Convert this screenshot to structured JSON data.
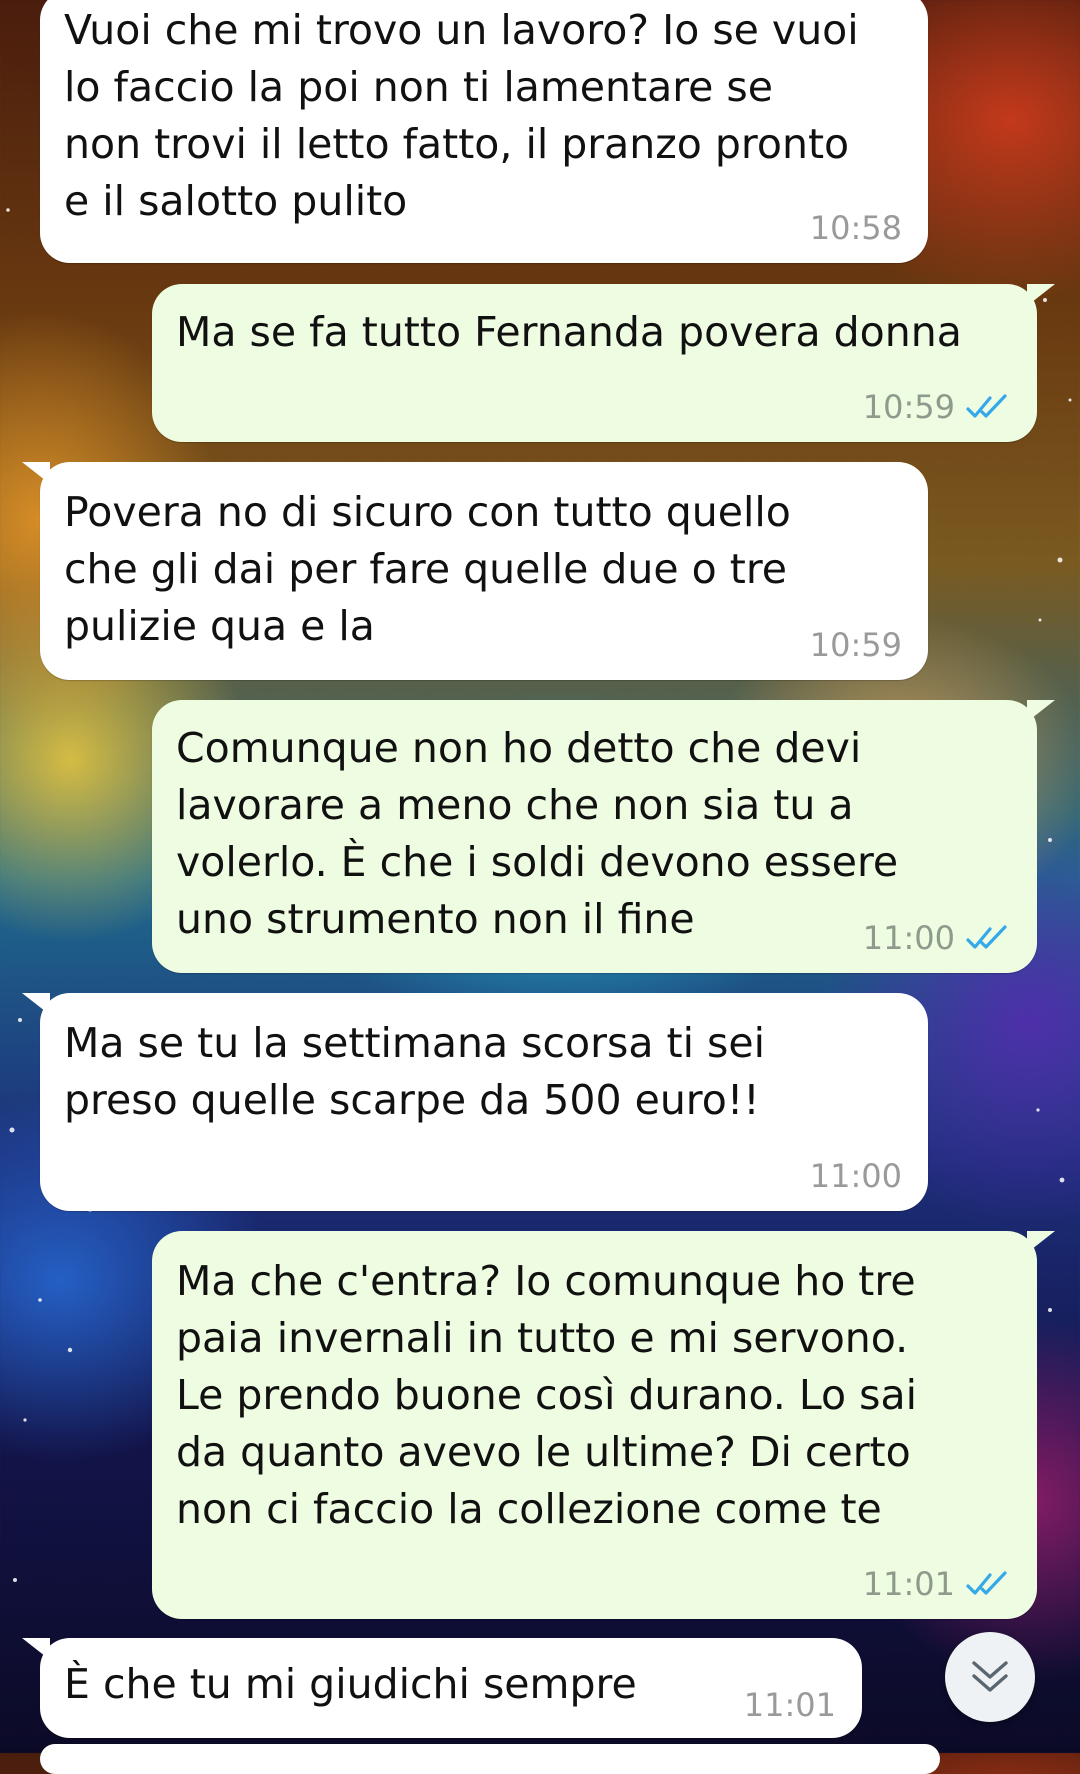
{
  "messages": [
    {
      "dir": "in",
      "text": "Vuoi che mi trovo un lavoro? Io se vuoi\nlo faccio la poi non ti lamentare se\nnon trovi il letto fatto, il pranzo pronto\ne il salotto pulito",
      "time": "10:58"
    },
    {
      "dir": "out",
      "text": "Ma se fa tutto Fernanda povera donna",
      "time": "10:59",
      "read": true
    },
    {
      "dir": "in",
      "text": "Povera no di sicuro con tutto quello\nche gli dai per fare quelle due o tre\npulizie qua e la",
      "time": "10:59"
    },
    {
      "dir": "out",
      "text": "Comunque non ho detto che devi\nlavorare a meno che non sia tu a\nvolerlo. È che i soldi devono essere\nuno strumento non il fine",
      "time": "11:00",
      "read": true
    },
    {
      "dir": "in",
      "text": "Ma se tu la settimana scorsa ti sei\npreso quelle scarpe da 500 euro!!",
      "time": "11:00"
    },
    {
      "dir": "out",
      "text": "Ma che c'entra? Io comunque ho tre\npaia invernali in tutto e mi servono.\nLe prendo buone così durano. Lo sai\nda quanto avevo le ultime? Di certo\nnon ci faccio la collezione come te",
      "time": "11:01",
      "read": true
    },
    {
      "dir": "in",
      "text": "È che tu mi giudichi sempre",
      "time": "11:01"
    }
  ],
  "colors": {
    "incoming_bubble": "#ffffff",
    "outgoing_bubble": "#eefde1",
    "read_ticks": "#34a8e8"
  },
  "icons": {
    "read_receipt": "double-check-icon",
    "scroll_down": "double-chevron-down-icon"
  }
}
